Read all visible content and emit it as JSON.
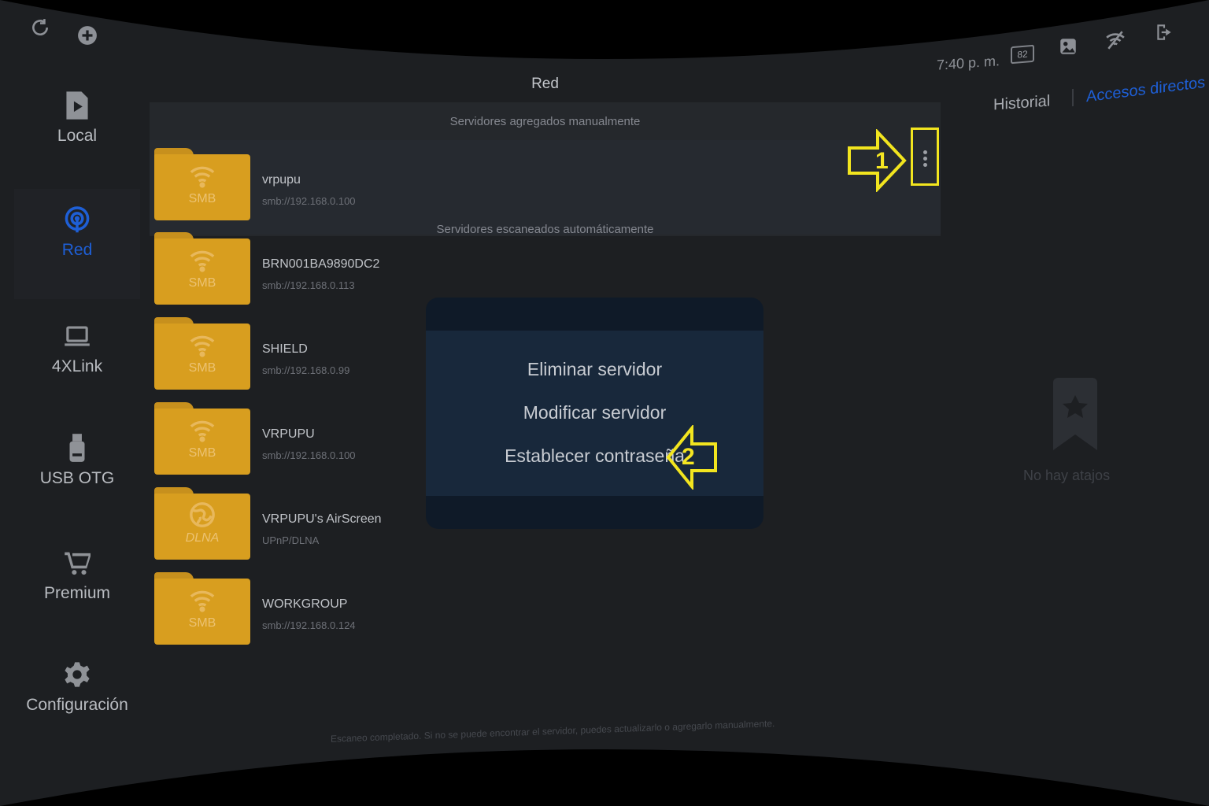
{
  "colors": {
    "accent": "#1e5fd6",
    "folder": "#d89e1f",
    "highlight": "#f2e51f",
    "background": "#1d1f22"
  },
  "top_bar": {
    "left_icons": [
      "refresh-icon",
      "add-icon"
    ],
    "time": "7:40 p. m.",
    "battery": "82",
    "right_icons": [
      "gallery-icon",
      "no-wifi-icon",
      "exit-icon"
    ]
  },
  "sidebar": {
    "items": [
      {
        "label": "Local",
        "icon": "play-file-icon",
        "active": false
      },
      {
        "label": "Red",
        "icon": "network-icon",
        "active": true
      },
      {
        "label": "4XLink",
        "icon": "laptop-icon",
        "active": false
      },
      {
        "label": "USB OTG",
        "icon": "usb-icon",
        "active": false
      },
      {
        "label": "Premium",
        "icon": "cart-icon",
        "active": false
      },
      {
        "label": "Configuración",
        "icon": "gear-icon",
        "active": false
      }
    ]
  },
  "main": {
    "title": "Red",
    "manual_section": "Servidores agregados manualmente",
    "scanned_section": "Servidores escaneados automáticamente",
    "manual_servers": [
      {
        "name": "vrpupu",
        "address": "smb://192.168.0.100",
        "type": "SMB"
      }
    ],
    "scanned_servers": [
      {
        "name": "BRN001BA9890DC2",
        "address": "smb://192.168.0.113",
        "type": "SMB"
      },
      {
        "name": "SHIELD",
        "address": "smb://192.168.0.99",
        "type": "SMB"
      },
      {
        "name": "VRPUPU",
        "address": "smb://192.168.0.100",
        "type": "SMB"
      },
      {
        "name": "VRPUPU's AirScreen",
        "address": "UPnP/DLNA",
        "type": "DLNA"
      },
      {
        "name": "WORKGROUP",
        "address": "smb://192.168.0.124",
        "type": "SMB"
      }
    ],
    "status": "Escaneo completado. Si no se puede encontrar el servidor, puedes actualizarlo o agregarlo manualmente."
  },
  "menu": {
    "items": [
      "Eliminar servidor",
      "Modificar servidor",
      "Establecer contraseña"
    ]
  },
  "callouts": {
    "first": "1",
    "second": "2"
  },
  "right_panel": {
    "tabs": [
      "Historial",
      "Accesos directos"
    ],
    "empty_text": "No hay atajos"
  }
}
